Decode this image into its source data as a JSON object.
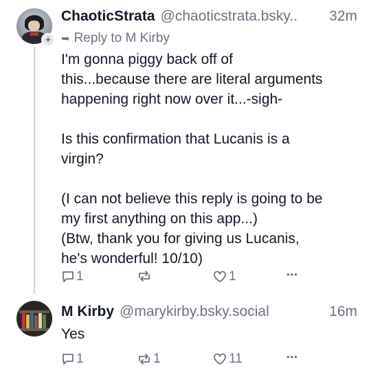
{
  "posts": [
    {
      "author_name": "ChaoticStrata",
      "handle": "@chaoticstrata.bsky..",
      "time": "32m",
      "reply_to": "Reply to M Kirby",
      "text": "I'm gonna piggy back off of\nthis...because there are literal arguments\nhappening right now over it...-sigh-\n\nIs this confirmation that Lucanis is a\nvirgin?\n\n(I can not believe this reply is going to be\nmy first anything on this app...)\n(Btw, thank you for giving us Lucanis,\nhe's wonderful! 10/10)",
      "reply_count": "1",
      "repost_count": "",
      "like_count": "1"
    },
    {
      "author_name": "M Kirby",
      "handle": "@marykirby.bsky.social",
      "time": "16m",
      "text": "Yes",
      "reply_count": "1",
      "repost_count": "1",
      "like_count": "11"
    }
  ],
  "icons": {
    "follow_badge": "plus-icon",
    "reply_indicator": "reply-arrow-icon",
    "reply": "speech-bubble-icon",
    "repost": "repost-icon",
    "like": "heart-icon",
    "more": "ellipsis-icon"
  },
  "symbols": {
    "plus": "+",
    "reply_arrow": "➥",
    "more": "•••"
  },
  "colors": {
    "text": "#111827",
    "muted": "#6b7280",
    "thread_line": "#d1d5db"
  }
}
